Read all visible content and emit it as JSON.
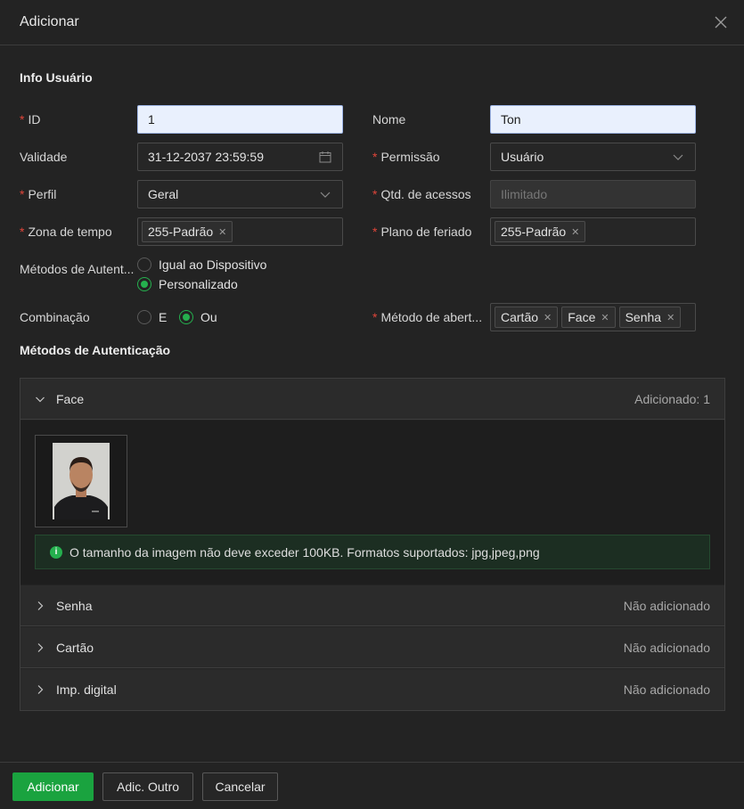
{
  "dialog": {
    "title": "Adicionar"
  },
  "user_info": {
    "section_title": "Info Usuário",
    "id": {
      "label": "ID",
      "value": "1"
    },
    "name": {
      "label": "Nome",
      "value": "Ton"
    },
    "validity": {
      "label": "Validade",
      "value": "31-12-2037 23:59:59"
    },
    "permission": {
      "label": "Permissão",
      "value": "Usuário"
    },
    "profile": {
      "label": "Perfil",
      "value": "Geral"
    },
    "access_count": {
      "label": "Qtd. de acessos",
      "placeholder": "Ilimitado"
    },
    "time_zone": {
      "label": "Zona de tempo",
      "tag": "255-Padrão"
    },
    "holiday_plan": {
      "label": "Plano de feriado",
      "tag": "255-Padrão"
    },
    "auth_methods": {
      "label": "Métodos de Autent...",
      "options": [
        "Igual ao Dispositivo",
        "Personalizado"
      ],
      "selected": "Personalizado"
    },
    "combination": {
      "label": "Combinação",
      "options": [
        "E",
        "Ou"
      ],
      "selected": "Ou"
    },
    "open_method": {
      "label": "Método de abert...",
      "tags": [
        "Cartão",
        "Face",
        "Senha"
      ]
    }
  },
  "auth_section": {
    "title": "Métodos de Autenticação",
    "items": [
      {
        "name": "Face",
        "status": "Adicionado: 1",
        "expanded": true
      },
      {
        "name": "Senha",
        "status": "Não adicionado",
        "expanded": false
      },
      {
        "name": "Cartão",
        "status": "Não adicionado",
        "expanded": false
      },
      {
        "name": "Imp. digital",
        "status": "Não adicionado",
        "expanded": false
      }
    ],
    "notice": "O tamanho da imagem não deve exceder 100KB. Formatos suportados: jpg,jpeg,png"
  },
  "footer": {
    "add_label": "Adicionar",
    "add_another_label": "Adic. Outro",
    "cancel_label": "Cancelar"
  },
  "colors": {
    "accent": "#1aa33f",
    "required": "#e0453a",
    "background": "#232323"
  }
}
